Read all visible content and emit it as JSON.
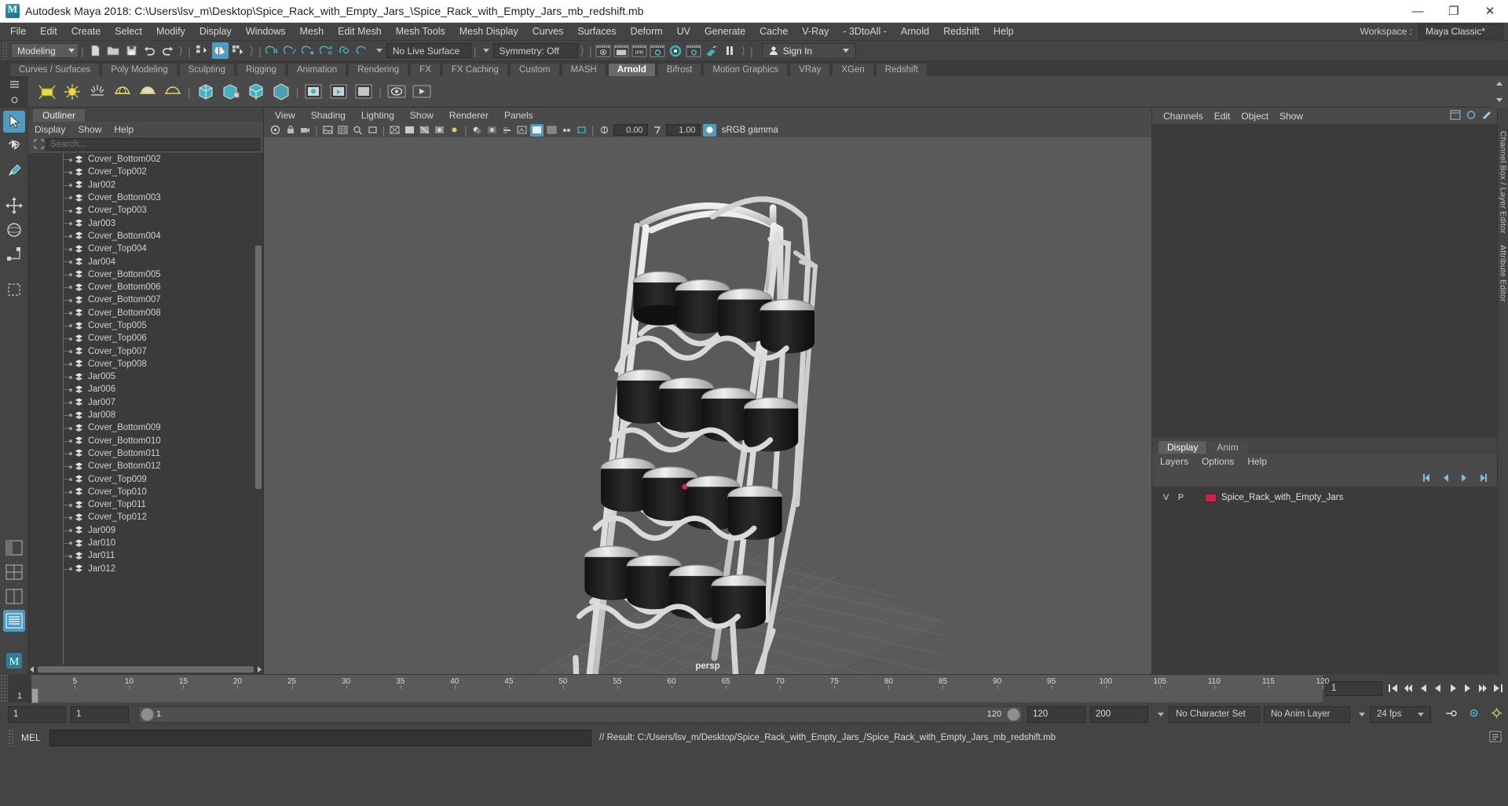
{
  "window": {
    "title": "Autodesk Maya 2018: C:\\Users\\lsv_m\\Desktop\\Spice_Rack_with_Empty_Jars_\\Spice_Rack_with_Empty_Jars_mb_redshift.mb",
    "logo_alt": "maya-logo",
    "minimize": "—",
    "maximize": "❐",
    "close": "✕"
  },
  "menubar": {
    "items": [
      "File",
      "Edit",
      "Create",
      "Select",
      "Modify",
      "Display",
      "Windows",
      "Mesh",
      "Edit Mesh",
      "Mesh Tools",
      "Mesh Display",
      "Curves",
      "Surfaces",
      "Deform",
      "UV",
      "Generate",
      "Cache",
      "V-Ray",
      "- 3DtoAll -",
      "Arnold",
      "Redshift",
      "Help"
    ],
    "workspace_label": "Workspace :",
    "workspace_value": "Maya Classic*"
  },
  "statusline": {
    "menuset": "Modeling",
    "live_surface": "No Live Surface",
    "symmetry": "Symmetry: Off",
    "signin": "Sign In",
    "icons": [
      "new-scene-icon",
      "open-scene-icon",
      "save-scene-icon",
      "undo-icon",
      "redo-icon",
      "select-hierarchy-icon",
      "select-object-icon",
      "select-component-icon",
      "snap-grid-icon",
      "snap-curve-icon",
      "snap-point-icon",
      "snap-projected-center-icon",
      "snap-view-plane-icon",
      "make-live-icon",
      "render-current-frame-icon",
      "ipr-render-icon",
      "render-settings-icon",
      "hypershade-icon",
      "render-view-icon",
      "light-toggle-icon",
      "pause-icon"
    ]
  },
  "shelf": {
    "tabs": [
      "Curves / Surfaces",
      "Poly Modeling",
      "Sculpting",
      "Rigging",
      "Animation",
      "Rendering",
      "FX",
      "FX Caching",
      "Custom",
      "MASH",
      "Arnold",
      "Bifrost",
      "Motion Graphics",
      "VRay",
      "XGen",
      "Redshift"
    ],
    "active_tab": "Arnold",
    "icons": [
      "arnold-area-light-icon",
      "arnold-point-light-icon",
      "arnold-distant-light-icon",
      "arnold-skydome-light-icon",
      "arnold-mesh-light-icon",
      "arnold-photometric-light-icon",
      "arnold-standin-icon",
      "arnold-volume-icon",
      "arnold-scene-source-icon",
      "arnold-flush-caches-icon",
      "arnold-render-icon",
      "arnold-render-sequence-icon",
      "arnold-open-render-view-icon",
      "arnold-render-selection-icon",
      "arnold-play-icon"
    ]
  },
  "toolbox": {
    "tools": [
      "select-tool",
      "lasso-select-tool",
      "paint-select-tool",
      "move-tool",
      "rotate-tool",
      "scale-tool",
      "last-tool-used",
      "show-manipulator-tool",
      "outliner-layout-icon",
      "persp-outliner-layout-icon",
      "four-view-layout-icon",
      "persp-graph-layout-icon",
      "outliner-panel-icon"
    ],
    "selected": "select-tool",
    "footer_logo": "maya-m-logo"
  },
  "outliner": {
    "tab_label": "Outliner",
    "menu": [
      "Display",
      "Show",
      "Help"
    ],
    "search_placeholder": "Search...",
    "search_value": "",
    "search_icon": "search-filter-icon",
    "items": [
      "Cover_Bottom002",
      "Cover_Top002",
      "Jar002",
      "Cover_Bottom003",
      "Cover_Top003",
      "Jar003",
      "Cover_Bottom004",
      "Cover_Top004",
      "Jar004",
      "Cover_Bottom005",
      "Cover_Bottom006",
      "Cover_Bottom007",
      "Cover_Bottom008",
      "Cover_Top005",
      "Cover_Top006",
      "Cover_Top007",
      "Cover_Top008",
      "Jar005",
      "Jar006",
      "Jar007",
      "Jar008",
      "Cover_Bottom009",
      "Cover_Bottom010",
      "Cover_Bottom011",
      "Cover_Bottom012",
      "Cover_Top009",
      "Cover_Top010",
      "Cover_Top011",
      "Cover_Top012",
      "Jar009",
      "Jar010",
      "Jar011",
      "Jar012"
    ]
  },
  "viewport": {
    "menu": [
      "View",
      "Shading",
      "Lighting",
      "Show",
      "Renderer",
      "Panels"
    ],
    "camera_label": "persp",
    "exposure_value": "0.00",
    "gamma_value": "1.00",
    "color_space": "sRGB gamma",
    "toolbar_icons": [
      "select-camera-icon",
      "lock-camera-icon",
      "camera-attributes-icon",
      "bookmark-icon",
      "image-plane-icon",
      "2d-pan-zoom-icon",
      "grid-icon",
      "film-gate-icon",
      "resolution-gate-icon",
      "gate-mask-icon",
      "xray-icon",
      "xray-joints-icon",
      "xray-active-components-icon",
      "exposure-icon",
      "gamma-icon",
      "wireframe-icon",
      "smooth-shade-icon",
      "smooth-shade-all-icon",
      "shaded-wireframe-icon",
      "textured-icon",
      "lighting-icon",
      "shadows-icon",
      "screen-space-ao-icon",
      "motion-blur-icon",
      "multisample-icon",
      "depth-peeling-icon",
      "isolate-select-icon",
      "hardware-texturing-icon",
      "two-sided-lighting-icon"
    ],
    "scene_description": "spice rack with empty jars 3d model"
  },
  "channelbox": {
    "tabs": [
      "Channels",
      "Edit",
      "Object",
      "Show"
    ],
    "side_labels": [
      "Channel Box / Layer Editor",
      "Attribute Editor"
    ]
  },
  "layers": {
    "tabs": [
      "Display",
      "Anim"
    ],
    "active_tab": "Display",
    "menu": [
      "Layers",
      "Options",
      "Help"
    ],
    "columns": [
      "V",
      "P"
    ],
    "rows": [
      {
        "v": "V",
        "p": "P",
        "color": "#d0214e",
        "name": "Spice_Rack_with_Empty_Jars"
      }
    ],
    "buttons": [
      "layer-first-icon",
      "layer-prev-icon",
      "layer-next-icon",
      "layer-last-icon"
    ]
  },
  "timeline": {
    "current_frame_left": "1",
    "ticks": [
      {
        "label": "5",
        "frame": 5
      },
      {
        "label": "10",
        "frame": 10
      },
      {
        "label": "15",
        "frame": 15
      },
      {
        "label": "20",
        "frame": 20
      },
      {
        "label": "25",
        "frame": 25
      },
      {
        "label": "30",
        "frame": 30
      },
      {
        "label": "35",
        "frame": 35
      },
      {
        "label": "40",
        "frame": 40
      },
      {
        "label": "45",
        "frame": 45
      },
      {
        "label": "50",
        "frame": 50
      },
      {
        "label": "55",
        "frame": 55
      },
      {
        "label": "60",
        "frame": 60
      },
      {
        "label": "65",
        "frame": 65
      },
      {
        "label": "70",
        "frame": 70
      },
      {
        "label": "75",
        "frame": 75
      },
      {
        "label": "80",
        "frame": 80
      },
      {
        "label": "85",
        "frame": 85
      },
      {
        "label": "90",
        "frame": 90
      },
      {
        "label": "95",
        "frame": 95
      },
      {
        "label": "100",
        "frame": 100
      },
      {
        "label": "105",
        "frame": 105
      },
      {
        "label": "110",
        "frame": 110
      },
      {
        "label": "115",
        "frame": 115
      },
      {
        "label": "120",
        "frame": 120
      }
    ],
    "range_start": 1,
    "range_end": 120,
    "frame_field": "1",
    "playback_icons": [
      "go-to-start-icon",
      "step-back-key-icon",
      "step-back-frame-icon",
      "play-backwards-icon",
      "play-forwards-icon",
      "step-forward-frame-icon",
      "step-forward-key-icon",
      "go-to-end-icon"
    ]
  },
  "rangeslider": {
    "anim_start": "1",
    "range_start": "1",
    "slider_left_label": "1",
    "slider_right_label": "120",
    "range_end": "120",
    "anim_end": "200",
    "character_set": "No Character Set",
    "anim_layer": "No Anim Layer",
    "fps": "24 fps",
    "icons": [
      "auto-key-icon",
      "animation-preferences-icon",
      "settings-gear-icon"
    ]
  },
  "commandline": {
    "label": "MEL",
    "input_value": "",
    "result": "// Result: C:/Users/lsv_m/Desktop/Spice_Rack_with_Empty_Jars_/Spice_Rack_with_Empty_Jars_mb_redshift.mb"
  },
  "colors": {
    "accent": "#4f9cc0",
    "panel_bg": "#444444",
    "list_bg": "#3b3b3b",
    "viewport_bg": "#5a5a5a",
    "layer_swatch": "#d0214e",
    "title_bg": "#ffffff"
  }
}
